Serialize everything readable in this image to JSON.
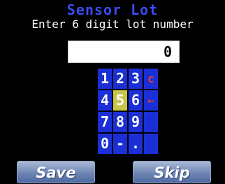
{
  "title": "Sensor Lot",
  "subtitle": "Enter 6 digit lot number",
  "display": {
    "value": "0"
  },
  "keypad": {
    "keys": [
      {
        "label": "1",
        "name": "key-1"
      },
      {
        "label": "2",
        "name": "key-2"
      },
      {
        "label": "3",
        "name": "key-3"
      },
      {
        "label": "c",
        "name": "clear-key"
      },
      {
        "label": "4",
        "name": "key-4"
      },
      {
        "label": "5",
        "name": "key-5",
        "selected": true
      },
      {
        "label": "6",
        "name": "key-6"
      },
      {
        "label": "←",
        "name": "backspace-key"
      },
      {
        "label": "7",
        "name": "key-7"
      },
      {
        "label": "8",
        "name": "key-8"
      },
      {
        "label": "9",
        "name": "key-9"
      },
      {
        "label": "",
        "name": "blank-key"
      },
      {
        "label": "0",
        "name": "key-0"
      },
      {
        "label": "-",
        "name": "minus-key"
      },
      {
        "label": ".",
        "name": "decimal-key"
      },
      {
        "label": "",
        "name": "blank-key"
      }
    ]
  },
  "buttons": {
    "save": "Save",
    "skip": "Skip"
  },
  "colors": {
    "accent": "#1b2fd6",
    "title": "#3a4cf0",
    "highlight": "#c9c44d",
    "action": "#e03a3a"
  }
}
